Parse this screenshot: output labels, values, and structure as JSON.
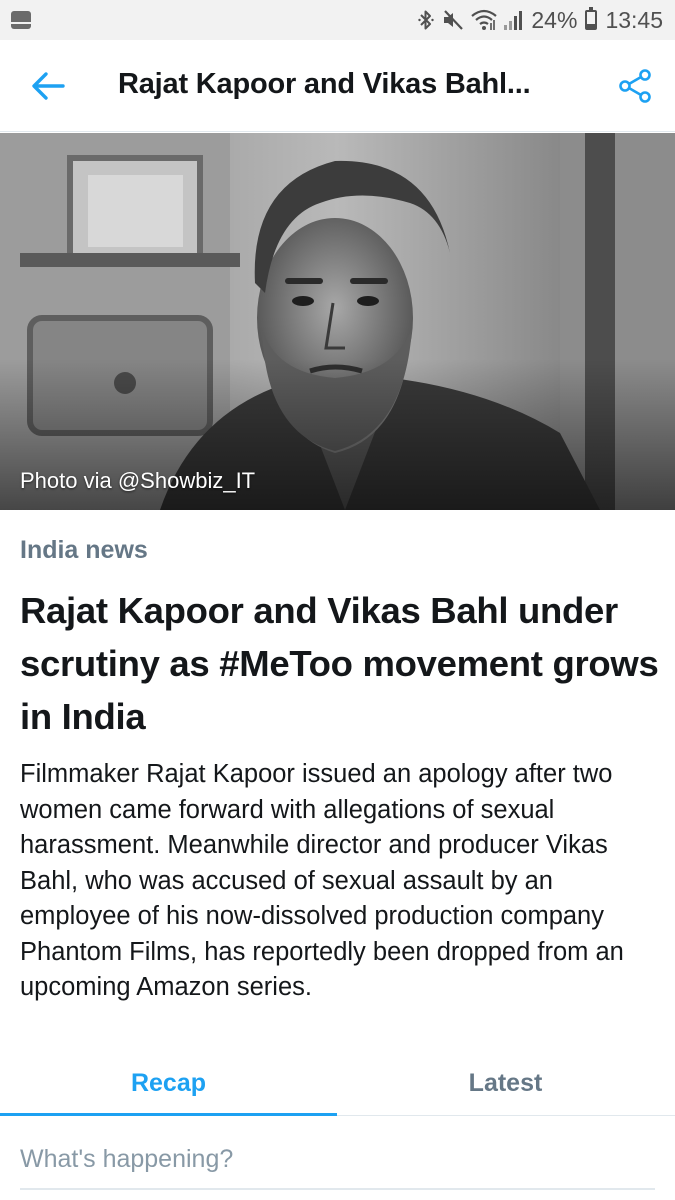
{
  "status_bar": {
    "battery_percent": "24%",
    "battery_level": 0.24,
    "time": "13:45",
    "icons": [
      "screenshot-icon",
      "bluetooth-icon",
      "mute-icon",
      "wifi-icon",
      "signal-icon",
      "battery-icon"
    ]
  },
  "header": {
    "title": "Rajat Kapoor and Vikas Bahl...",
    "back_icon": "arrow-left-icon",
    "share_icon": "share-icon",
    "accent_color": "#1da1f2"
  },
  "hero": {
    "caption": "Photo via @Showbiz_IT"
  },
  "article": {
    "category": "India news",
    "headline": "Rajat Kapoor and Vikas Bahl under scrutiny as #MeToo movement grows in India",
    "summary": "Filmmaker Rajat Kapoor issued an apology after two women came forward with allegations of sexual harassment. Meanwhile director and producer Vikas Bahl, who was accused of sexual assault by an employee of his now-dissolved pro­duction company Phantom Films, has reportedly been dropped from an upcoming Amazon series."
  },
  "tabs": [
    {
      "label": "Recap",
      "active": true
    },
    {
      "label": "Latest",
      "active": false
    }
  ],
  "compose": {
    "placeholder": "What's happening?"
  }
}
